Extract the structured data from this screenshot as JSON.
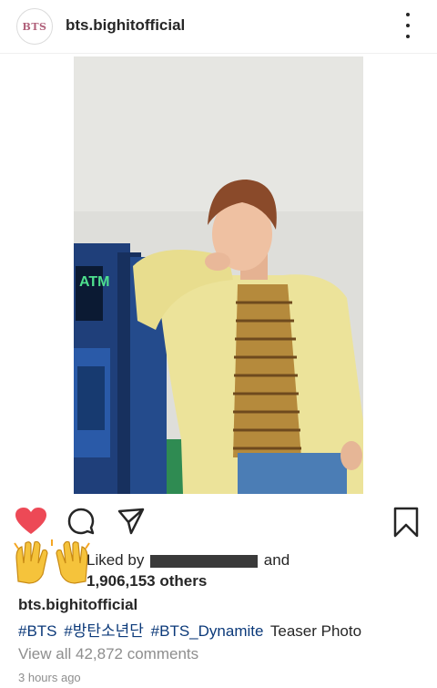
{
  "post": {
    "avatar_text": "BTS",
    "username": "bts.bighitofficial"
  },
  "photo": {
    "atm_sign": "ATM",
    "description": "photo"
  },
  "actions": {
    "icons": [
      "heart-icon",
      "comment-icon",
      "share-icon",
      "bookmark-icon"
    ],
    "liked_color": "#ed4956"
  },
  "likes": {
    "liked_by_prefix": "Liked by",
    "liked_by_suffix": "and",
    "others": "1,906,153 others"
  },
  "caption": {
    "username": "bts.bighitofficial",
    "hashtag1": "#BTS",
    "hashtag2": "#방탄소년단",
    "hashtag3": "#BTS_Dynamite",
    "text": "Teaser Photo"
  },
  "comments": {
    "view_all": "View all 42,872 comments"
  },
  "timestamp": "3 hours ago"
}
